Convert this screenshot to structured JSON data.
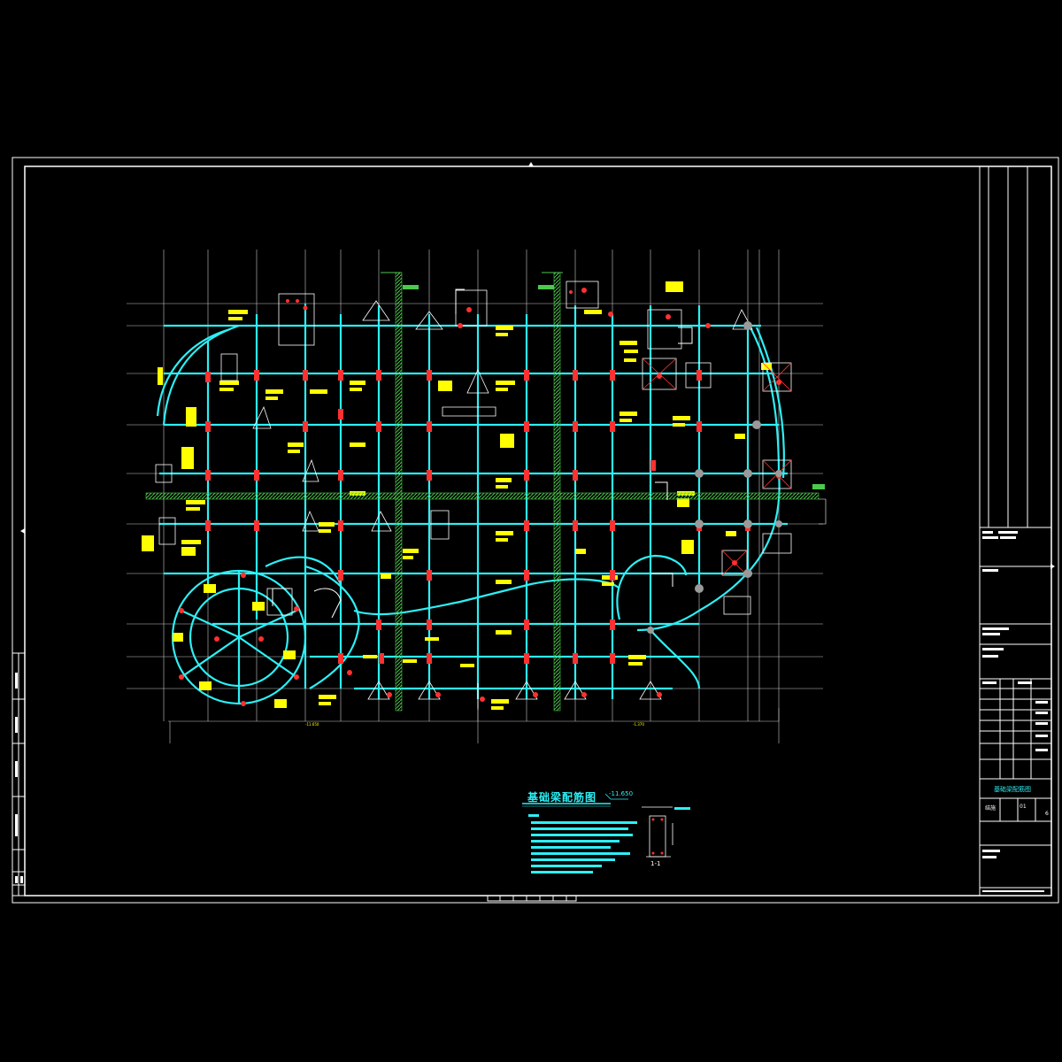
{
  "drawing": {
    "title": "基础梁配筋图",
    "elevation_tag": "-11.650",
    "left_dimension_note": "-11.650",
    "right_dimension_note": "-1.370",
    "section_tag": "1-1"
  },
  "title_block": {
    "sheet_name": "基础梁配筋图",
    "drawing_number": "结施",
    "drawing_number_suffix": "01",
    "sheet_index": "6"
  },
  "colors": {
    "background": "#000000",
    "frame": "#ffffff",
    "grid": "#c8c8c8",
    "beam": "#2cf0f5",
    "annotation": "#ffff00",
    "column": "#ff3030",
    "post_wall": "#4cc84c"
  }
}
